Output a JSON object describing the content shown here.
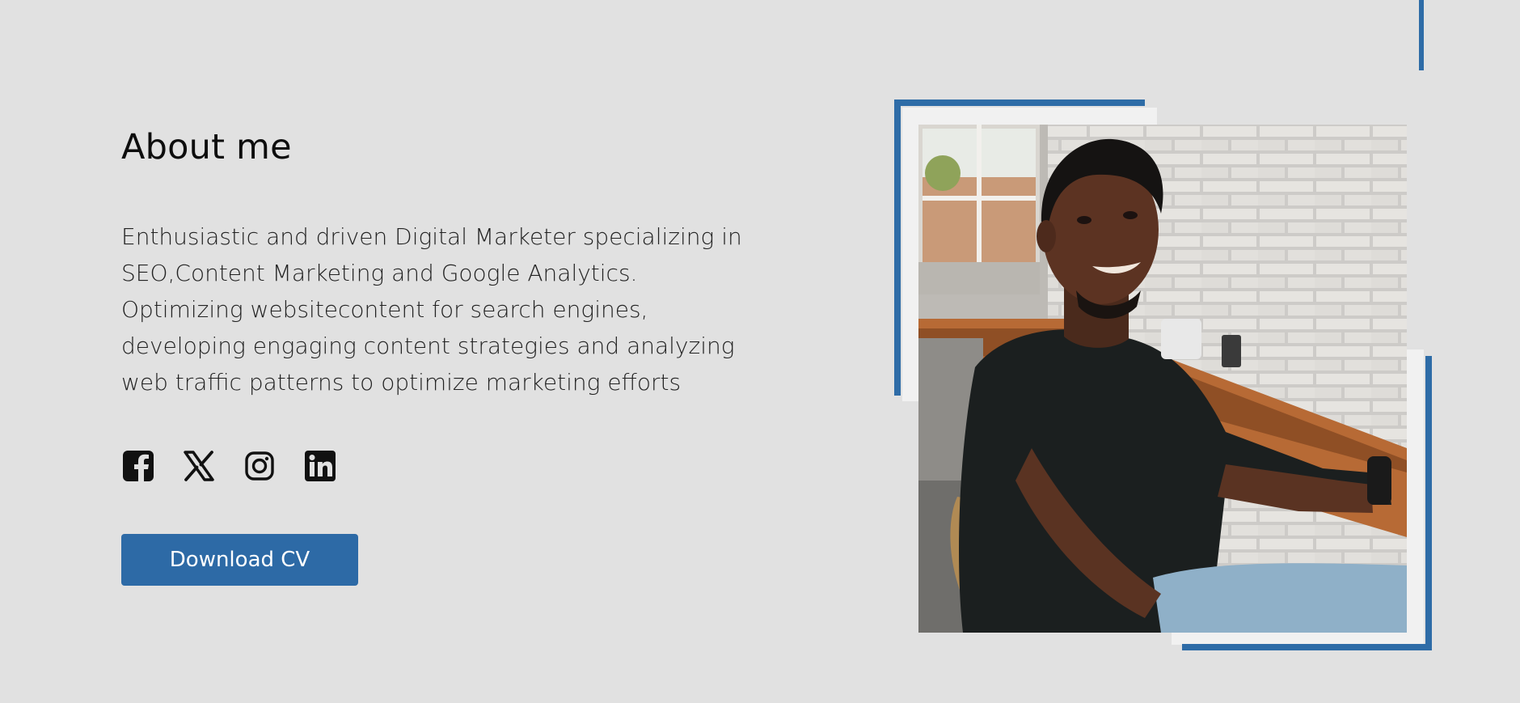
{
  "about": {
    "title": "About me",
    "description": "Enthusiastic and driven Digital Marketer specializing in SEO,Content Marketing and Google Analytics. Optimizing websitecontent for search engines, developing engaging content strategies and analyzing web traffic patterns to optimize marketing efforts"
  },
  "socials": [
    {
      "name": "Facebook",
      "icon": "facebook-icon"
    },
    {
      "name": "X",
      "icon": "x-twitter-icon"
    },
    {
      "name": "Instagram",
      "icon": "instagram-icon"
    },
    {
      "name": "LinkedIn",
      "icon": "linkedin-icon"
    }
  ],
  "cta": {
    "download_label": "Download CV"
  },
  "colors": {
    "background": "#e1e1e1",
    "accent": "#2e6ca7",
    "button": "#2d6aa6"
  }
}
